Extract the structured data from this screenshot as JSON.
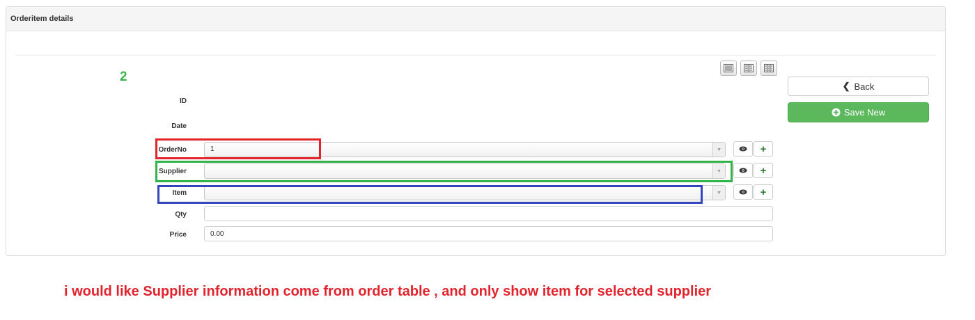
{
  "panel": {
    "title": "Orderitem details"
  },
  "record_number": "2",
  "form": {
    "id": {
      "label": "ID"
    },
    "date": {
      "label": "Date"
    },
    "orderno": {
      "label": "OrderNo",
      "value": "1"
    },
    "supplier": {
      "label": "Supplier",
      "value": ""
    },
    "item": {
      "label": "Item",
      "value": ""
    },
    "qty": {
      "label": "Qty",
      "value": ""
    },
    "price": {
      "label": "Price",
      "value": "0.00"
    }
  },
  "actions": {
    "back_label": "Back",
    "save_new_label": "Save New"
  },
  "annotation": {
    "note": "i would like Supplier information come from order table , and only show item for selected supplier",
    "colors": {
      "orderno": "#e3232c",
      "supplier": "#2fb34a",
      "item": "#3346c0"
    }
  },
  "icons": {
    "layout_1col": "layout-one-column-icon",
    "layout_2col": "layout-two-column-icon",
    "layout_3col": "layout-three-column-icon",
    "view": "eye-icon",
    "add": "plus-icon",
    "back": "chevron-left-icon",
    "save": "plus-circle-icon"
  }
}
